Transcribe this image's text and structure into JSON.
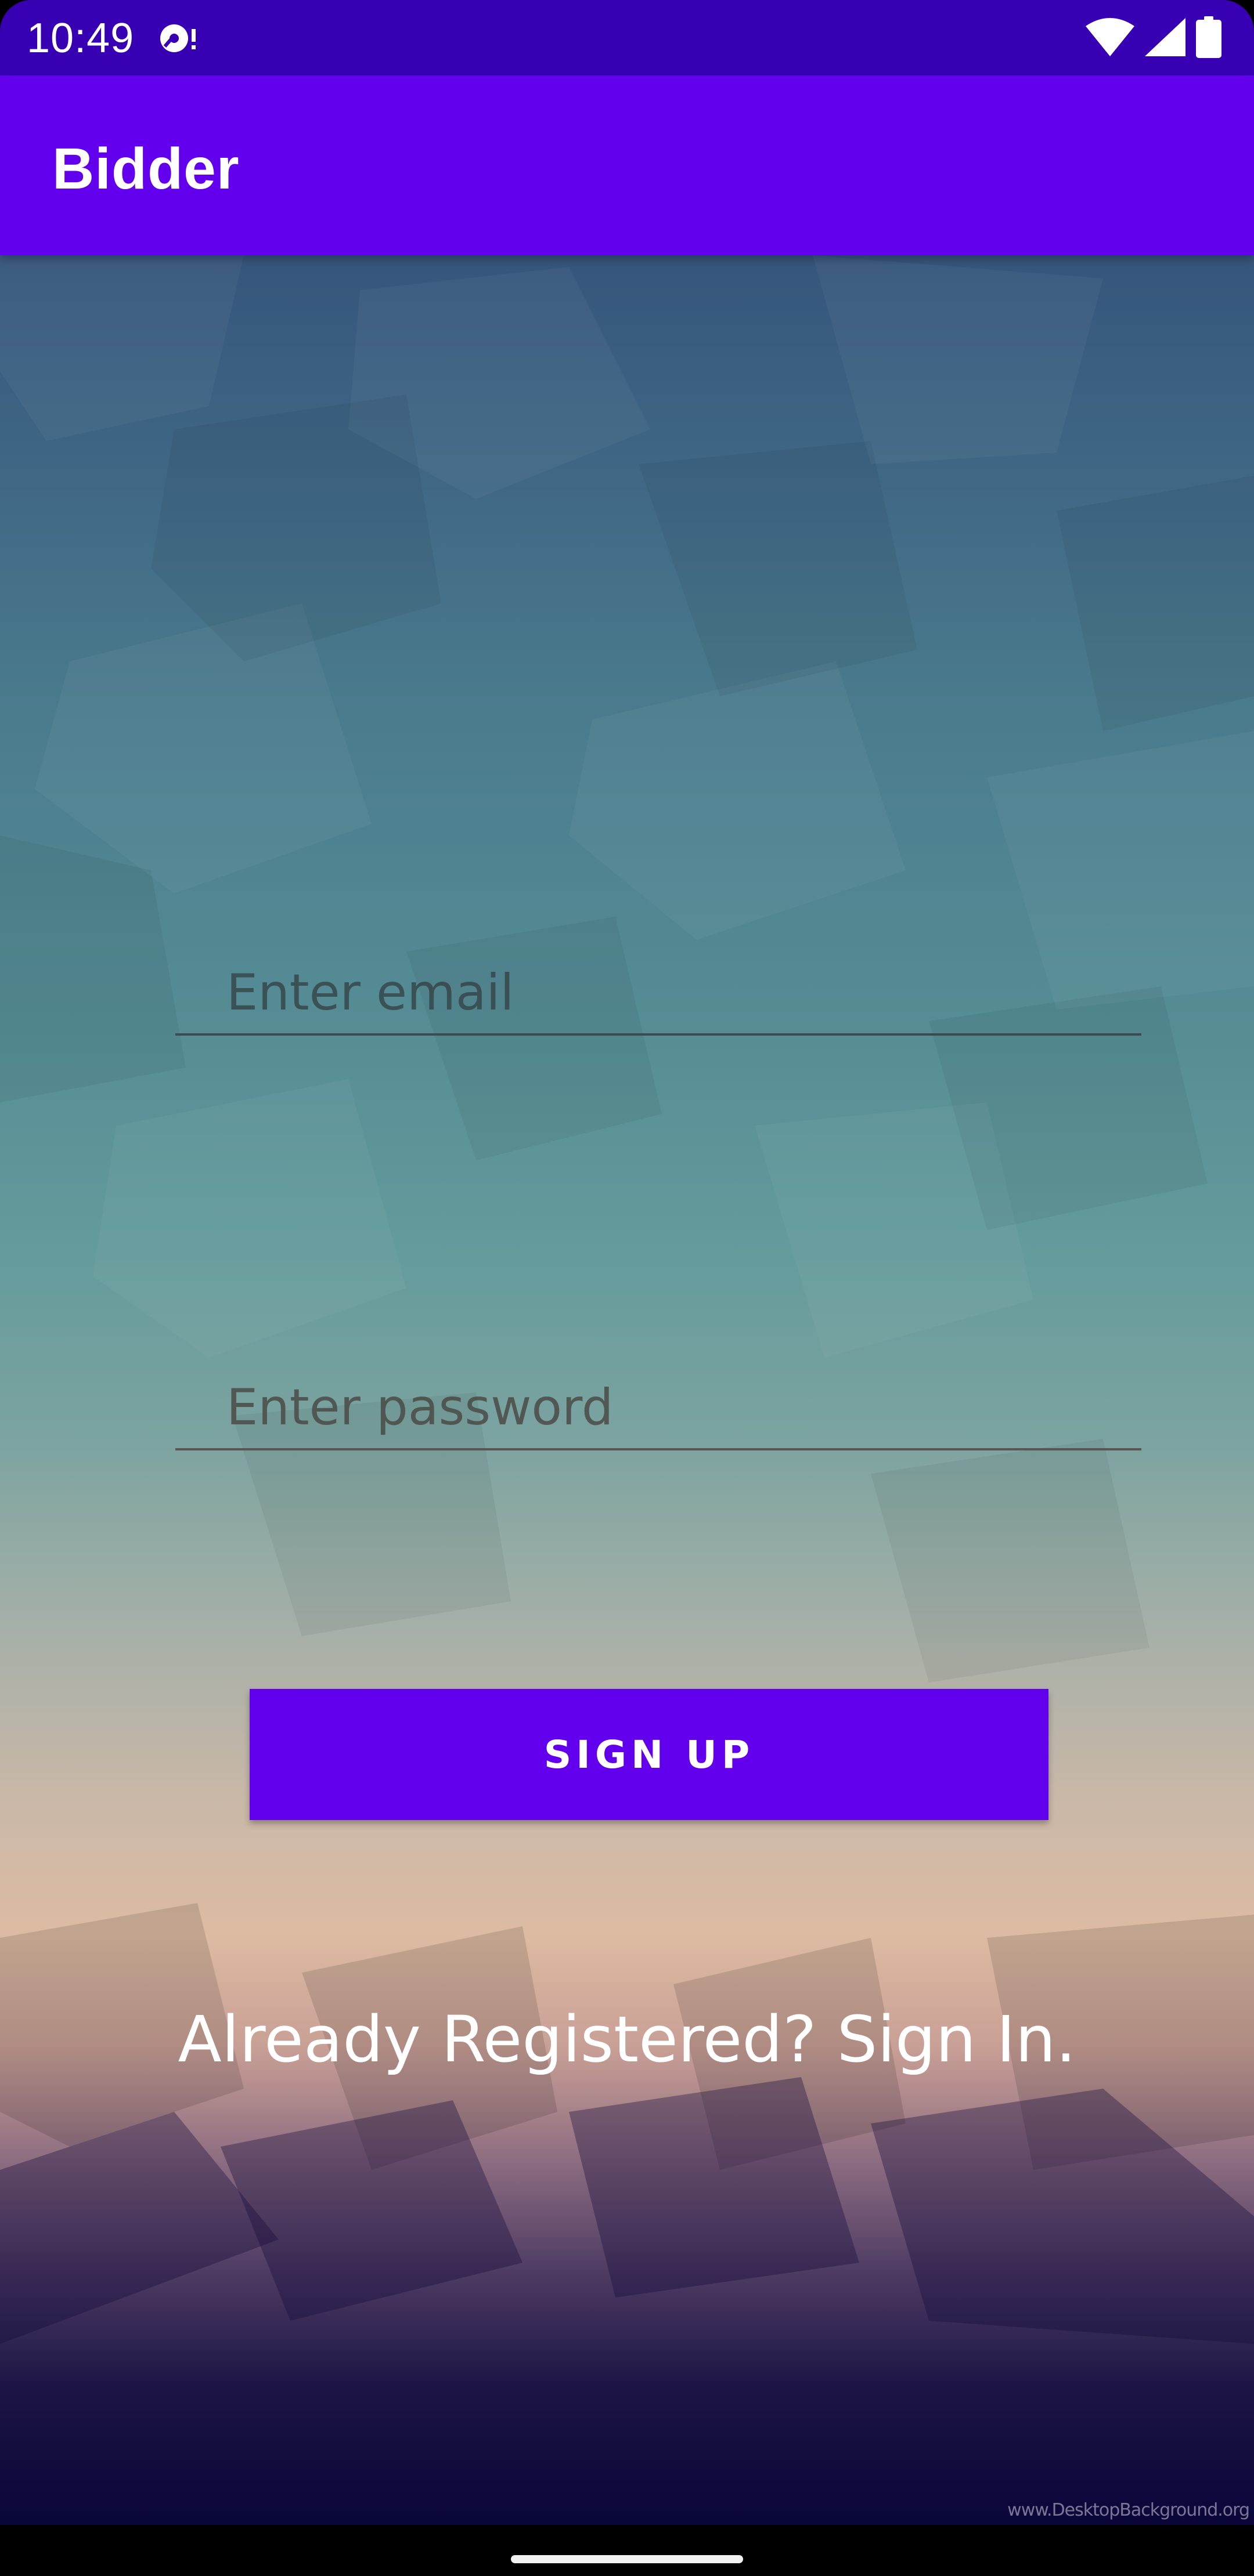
{
  "status_bar": {
    "time": "10:49",
    "icons": [
      "media-icon",
      "wifi-icon",
      "signal-icon",
      "battery-icon"
    ]
  },
  "app_bar": {
    "title": "Bidder"
  },
  "form": {
    "email_placeholder": "Enter email",
    "password_placeholder": "Enter password",
    "signup_label": "SIGN UP",
    "signin_link": "Already Registered? Sign In."
  },
  "background": {
    "watermark": "www.DesktopBackground.org"
  },
  "colors": {
    "primary": "#6200ee",
    "primary_dark": "#3700b3",
    "on_primary": "#ffffff"
  }
}
